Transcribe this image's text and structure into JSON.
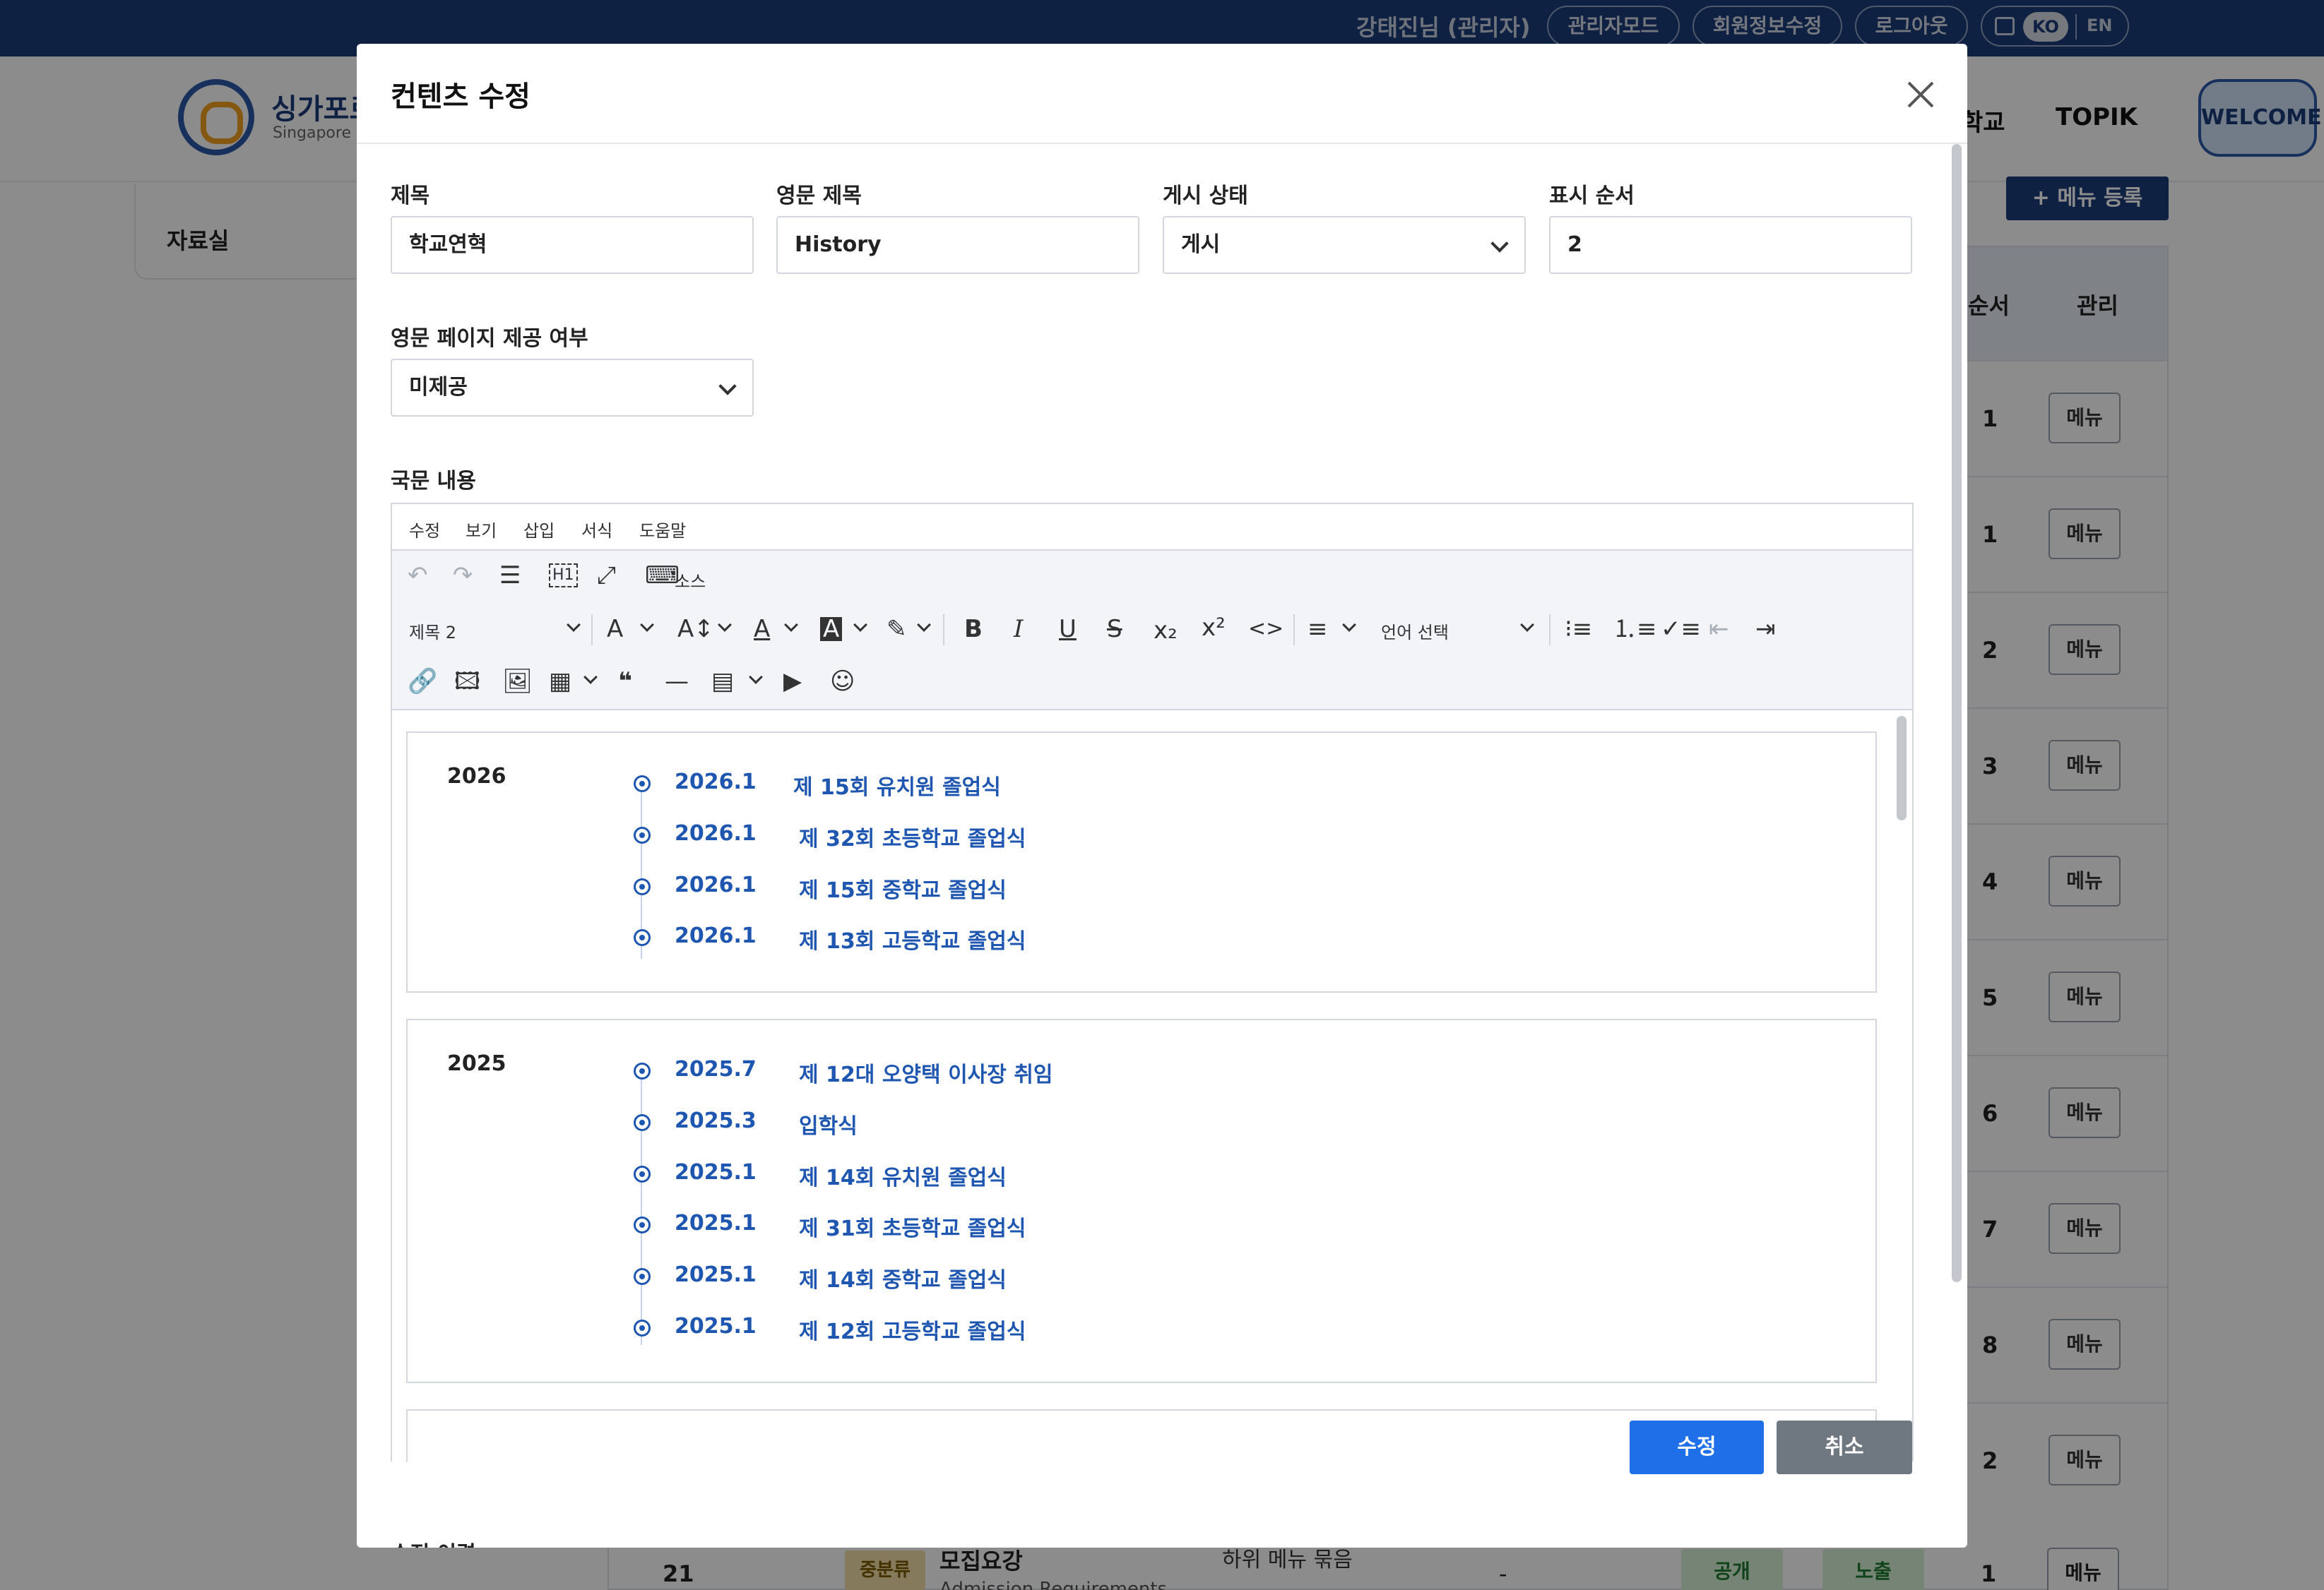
{
  "topbar": {
    "user": "강태진님 (관리자)",
    "admin_mode": "관리자모드",
    "edit_profile": "회원정보수정",
    "logout": "로그아웃",
    "lang_ko": "KO",
    "lang_en": "EN"
  },
  "site": {
    "brand": "싱가포르",
    "brand_sub": "Singapore K",
    "nav": [
      "학교",
      "TOPIK"
    ],
    "welcome": "WELCOME"
  },
  "background": {
    "sidebar_item": "자료실",
    "add_menu_button": "+ 메뉴 등록",
    "table_headers": {
      "order": "순서",
      "manage": "관리"
    },
    "rows": [
      {
        "order": "1",
        "button": "메뉴"
      },
      {
        "order": "1",
        "button": "메뉴"
      },
      {
        "order": "2",
        "button": "메뉴"
      },
      {
        "order": "3",
        "button": "메뉴"
      },
      {
        "order": "4",
        "button": "메뉴"
      },
      {
        "order": "5",
        "button": "메뉴"
      },
      {
        "order": "6",
        "button": "메뉴"
      },
      {
        "order": "7",
        "button": "메뉴"
      },
      {
        "order": "8",
        "button": "메뉴"
      },
      {
        "order": "2",
        "button": "메뉴"
      }
    ],
    "last_row": {
      "num": "21",
      "badge": "중분류",
      "name": "모집요강",
      "sub": "Admission Requirements",
      "menu_type": "하위 메뉴 묶음",
      "dash": "-",
      "status1": "공개",
      "status2": "노출",
      "order": "1",
      "button": "메뉴"
    }
  },
  "modal": {
    "title": "컨텐츠 수정",
    "fields": {
      "title_label": "제목",
      "title_value": "학교연혁",
      "en_title_label": "영문 제목",
      "en_title_value": "History",
      "status_label": "게시 상태",
      "status_value": "게시",
      "order_label": "표시 순서",
      "order_value": "2",
      "en_page_label": "영문 페이지 제공 여부",
      "en_page_value": "미제공",
      "content_label": "국문 내용"
    },
    "editor": {
      "menus": [
        "수정",
        "보기",
        "삽입",
        "서식",
        "도움말"
      ],
      "source_label": "소스",
      "block_format": "제목 2",
      "language_select": "언어 선택",
      "icons": {
        "undo": "undo-icon",
        "redo": "redo-icon",
        "select_all": "select-all-icon",
        "heading": "heading-icon",
        "fullscreen": "fullscreen-icon",
        "source": "source-code-icon",
        "font_size": "font-size-icon",
        "line_height": "line-height-icon",
        "text_color": "text-color-icon",
        "bg_color": "background-color-icon",
        "highlight": "highlight-icon",
        "bold": "bold-icon",
        "italic": "italic-icon",
        "underline": "underline-icon",
        "strike": "strikethrough-icon",
        "subscript": "subscript-icon",
        "superscript": "superscript-icon",
        "code": "code-icon",
        "align": "align-icon",
        "bullet_list": "bullet-list-icon",
        "numbered_list": "numbered-list-icon",
        "checklist": "checklist-icon",
        "outdent": "outdent-icon",
        "indent": "indent-icon",
        "link": "link-icon",
        "image": "image-icon",
        "upload_image": "upload-image-icon",
        "table": "table-icon",
        "quote": "blockquote-icon",
        "hr": "horizontal-line-icon",
        "template": "template-icon",
        "media": "media-icon",
        "emoji": "emoji-icon"
      },
      "timeline": [
        {
          "year": "2026",
          "items": [
            {
              "date": "2026.1",
              "text": "제 15회 유치원 졸업식"
            },
            {
              "date": "2026.1",
              "text": "제 32회 초등학교 졸업식"
            },
            {
              "date": "2026.1",
              "text": "제 15회 중학교 졸업식"
            },
            {
              "date": "2026.1",
              "text": "제 13회 고등학교 졸업식"
            }
          ]
        },
        {
          "year": "2025",
          "items": [
            {
              "date": "2025.7",
              "text": "제 12대 오양택 이사장 취임"
            },
            {
              "date": "2025.3",
              "text": "입학식"
            },
            {
              "date": "2025.1",
              "text": "제 14회 유치원 졸업식"
            },
            {
              "date": "2025.1",
              "text": "제 31회 초등학교 졸업식"
            },
            {
              "date": "2025.1",
              "text": "제 14회 중학교 졸업식"
            },
            {
              "date": "2025.1",
              "text": "제 12회 고등학교 졸업식"
            }
          ]
        }
      ]
    },
    "buttons": {
      "submit": "수정",
      "cancel": "취소"
    },
    "cut_label": "수정 이력"
  },
  "colors": {
    "topbar": "#1c3c7a",
    "primary": "#1e6fe8",
    "timeline": "#1e56b0",
    "cancel": "#6f7780"
  }
}
